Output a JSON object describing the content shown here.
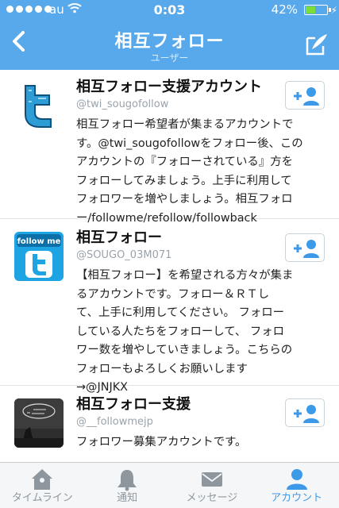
{
  "status": {
    "carrier": "au",
    "time": "0:03",
    "battery": "42%"
  },
  "nav": {
    "title": "相互フォロー",
    "subtitle": "ユーザー"
  },
  "users": [
    {
      "name": "相互フォロー支援アカウント",
      "handle": "@twi_sougofollow",
      "bio": "相互フォロー希望者が集まるアカウントで\nす。@twi_sougofollowをフォロー後、この\nアカウントの『フォローされている』方を\nフォローしてみましょう。上手に利用して\nフォロワーを増やしましょう。相互フォロ\nー/followme/refollow/followback"
    },
    {
      "name": "相互フォロー",
      "handle": "@SOUGO_03M071",
      "bio": "【相互フォロー】を希望される方々が集ま\nるアカウントです。フォロー＆ＲＴし\nて、上手に利用してください。 フォロー\nしている人たちをフォローして、 フォロ\nワー数を増やしていきましょう。こちらの\nフォローもよろしくお願いします\n→@JNJKX"
    },
    {
      "name": "相互フォロー支援",
      "handle": "@__followmejp",
      "bio": "フォロワー募集アカウントです。"
    }
  ],
  "avatar_text": {
    "follow_me": "follow me"
  },
  "tabs": [
    {
      "label": "タイムライン",
      "icon": "home-icon",
      "active": false
    },
    {
      "label": "通知",
      "icon": "bell-icon",
      "active": false
    },
    {
      "label": "メッセージ",
      "icon": "envelope-icon",
      "active": false
    },
    {
      "label": "アカウント",
      "icon": "person-icon",
      "active": true
    }
  ],
  "colors": {
    "nav_bg": "#58a9eb",
    "accent": "#3d9ae8",
    "battery_fill": "#7ddc3a"
  }
}
